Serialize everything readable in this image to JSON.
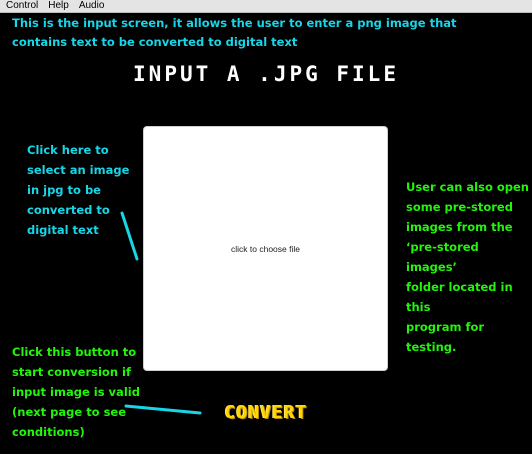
{
  "menubar": {
    "items": [
      {
        "label": "Control"
      },
      {
        "label": "Help"
      },
      {
        "label": "Audio"
      }
    ]
  },
  "annotations": {
    "intro_line1": "This is the input screen, it allows the user to enter a png image that",
    "intro_line2": "contains text to be converted to digital text",
    "select_note": [
      "Click here to",
      "select an image",
      "in jpg to be",
      "converted to",
      "digital text"
    ],
    "stored_note": [
      "User can also open",
      "some pre-stored",
      "images from the",
      "‘pre-stored images’",
      "folder located in this",
      "program for testing."
    ],
    "convert_note": [
      "Click this button to",
      "start conversion if",
      "input image is valid",
      "(next page to see",
      "conditions)"
    ]
  },
  "screen": {
    "title": "INPUT A .JPG FILE",
    "dropzone_label": "click to choose file",
    "convert_label": "CONVERT"
  },
  "colors": {
    "background": "#000000",
    "annotation_cyan": "#16d6e8",
    "annotation_green": "#22f50a",
    "convert_yellow": "#ffd400",
    "title_white": "#ffffff"
  }
}
